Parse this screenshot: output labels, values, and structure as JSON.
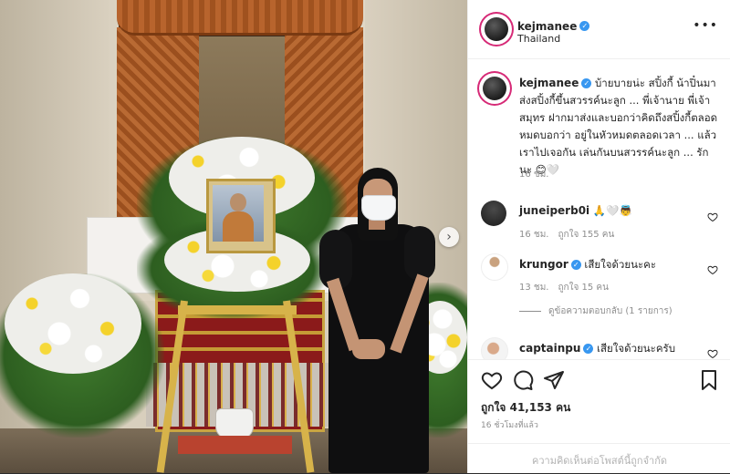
{
  "post": {
    "username": "kejmanee",
    "location": "Thailand",
    "caption": "บ้ายบายน่ะ สปิ้งกี้ น้าปิ๋นมาส่งสปิ้งกี้ขึ้นสวรรค์นะลูก ... พี่เจ้านาย พี่เจ้าสมุทร ฝากมาส่งและบอกว่าคิดถึงสปิ้งกี้ตลอด หมดบอกว่า อยู่ในหัวหมดตลอดเวลา ... แล้วเราไปเจอกัน เล่นกันบนสวรรค์นะลูก ... รักนะ 😊🤍",
    "caption_time": "16 ชม.",
    "likes": "ถูกใจ 41,153 คน",
    "posted_ago": "16 ชั่วโมงที่แล้ว",
    "add_comment_placeholder": "ความคิดเห็นต่อโพสต์นี้ถูกจำกัด",
    "more_label": "•••"
  },
  "comments": [
    {
      "user": "juneiperb0i",
      "text": "🙏🤍👼",
      "time": "16 ชม.",
      "likes": "ถูกใจ 155 คน"
    },
    {
      "user": "krungor",
      "text": "เสียใจด้วยนะคะ",
      "time": "13 ชม.",
      "likes": "ถูกใจ 15 คน"
    },
    {
      "user": "captainpu",
      "text": "เสียใจด้วยนะครับ"
    }
  ],
  "view_replies": "ดูข้อความตอบกลับ (1 รายการ)",
  "colors": {
    "accent": "#3897f0",
    "story_ring": "#d62976",
    "text": "#262626",
    "muted": "#8e8e8e"
  },
  "icons": [
    "more-icon",
    "verified-icon",
    "heart-icon",
    "comment-icon",
    "share-icon",
    "bookmark-icon",
    "next-arrow-icon"
  ]
}
